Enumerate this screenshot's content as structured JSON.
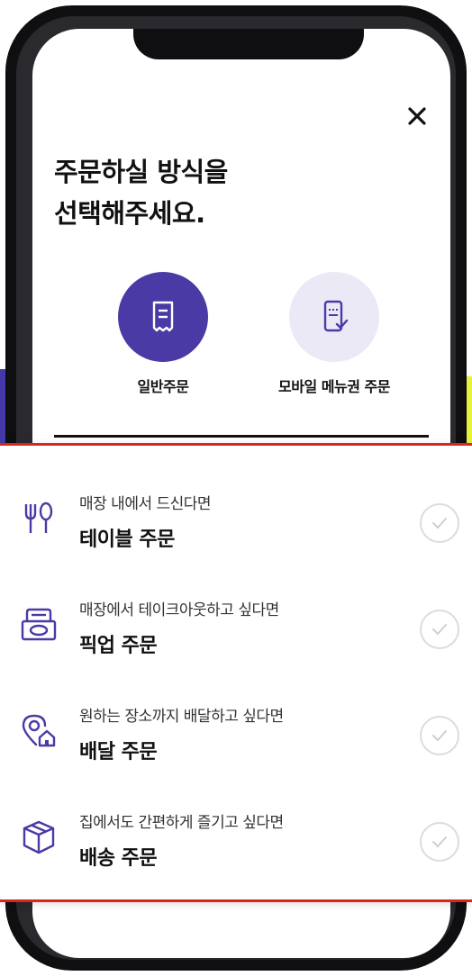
{
  "header": {
    "title_line1": "주문하실 방식을",
    "title_line2": "선택해주세요."
  },
  "modes": [
    {
      "label": "일반주문",
      "icon": "receipt-icon",
      "selected": true
    },
    {
      "label": "모바일 메뉴권 주문",
      "icon": "mobile-ticket-icon",
      "selected": false
    }
  ],
  "options": [
    {
      "subtitle": "매장 내에서 드신다면",
      "title": "테이블 주문",
      "icon": "utensils-icon"
    },
    {
      "subtitle": "매장에서 테이크아웃하고 싶다면",
      "title": "픽업 주문",
      "icon": "takeout-box-icon"
    },
    {
      "subtitle": "원하는 장소까지 배달하고 싶다면",
      "title": "배달 주문",
      "icon": "location-home-icon"
    },
    {
      "subtitle": "집에서도 간편하게 즐기고 싶다면",
      "title": "배송 주문",
      "icon": "package-icon"
    }
  ],
  "colors": {
    "accent": "#4a3aa6",
    "accent_light": "#ece9f6",
    "highlight_border": "#d7261e"
  }
}
